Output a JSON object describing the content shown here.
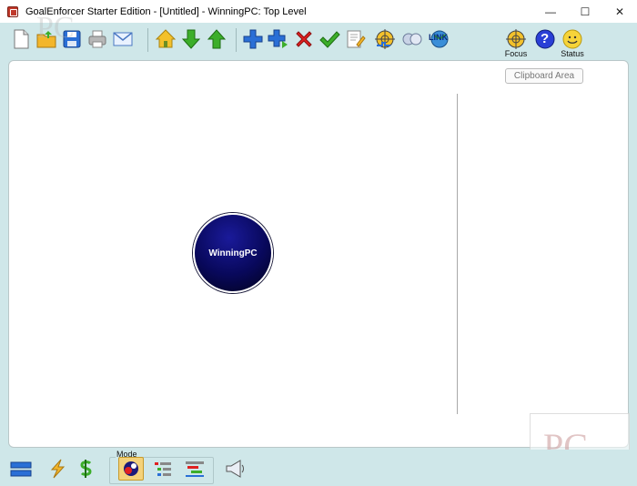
{
  "window": {
    "title": "GoalEnforcer Starter Edition  -  [Untitled]  -  WinningPC: Top Level",
    "minimize_glyph": "—",
    "maximize_glyph": "☐",
    "close_glyph": "✕"
  },
  "toolbar": {
    "buttons": [
      {
        "icon": "new-document-icon"
      },
      {
        "icon": "open-folder-icon"
      },
      {
        "icon": "save-disk-icon"
      },
      {
        "icon": "print-icon"
      },
      {
        "icon": "email-icon"
      },
      {
        "icon": "home-icon"
      },
      {
        "icon": "arrow-down-icon"
      },
      {
        "icon": "arrow-up-icon"
      },
      {
        "icon": "add-sibling-icon"
      },
      {
        "icon": "add-subgoal-icon"
      },
      {
        "icon": "delete-icon"
      },
      {
        "icon": "checkmark-icon"
      },
      {
        "icon": "notes-icon"
      },
      {
        "icon": "focus-add-icon"
      },
      {
        "icon": "link-circles-icon"
      },
      {
        "icon": "link-globe-icon"
      }
    ],
    "link_text": "LINK",
    "focus_label": "Focus",
    "status_label": "Status",
    "help_glyph": "?"
  },
  "canvas": {
    "clipboard_label": "Clipboard Area",
    "goal_node": {
      "label": "WinningPC",
      "color": "#08085a"
    }
  },
  "bottombar": {
    "mode_label": "Mode"
  },
  "watermark": {
    "text": "PC"
  },
  "colors": {
    "accent_green": "#3cae2a",
    "accent_blue": "#2a6fd6",
    "delete_red": "#e02020",
    "window_bg": "#cfe7e9"
  }
}
